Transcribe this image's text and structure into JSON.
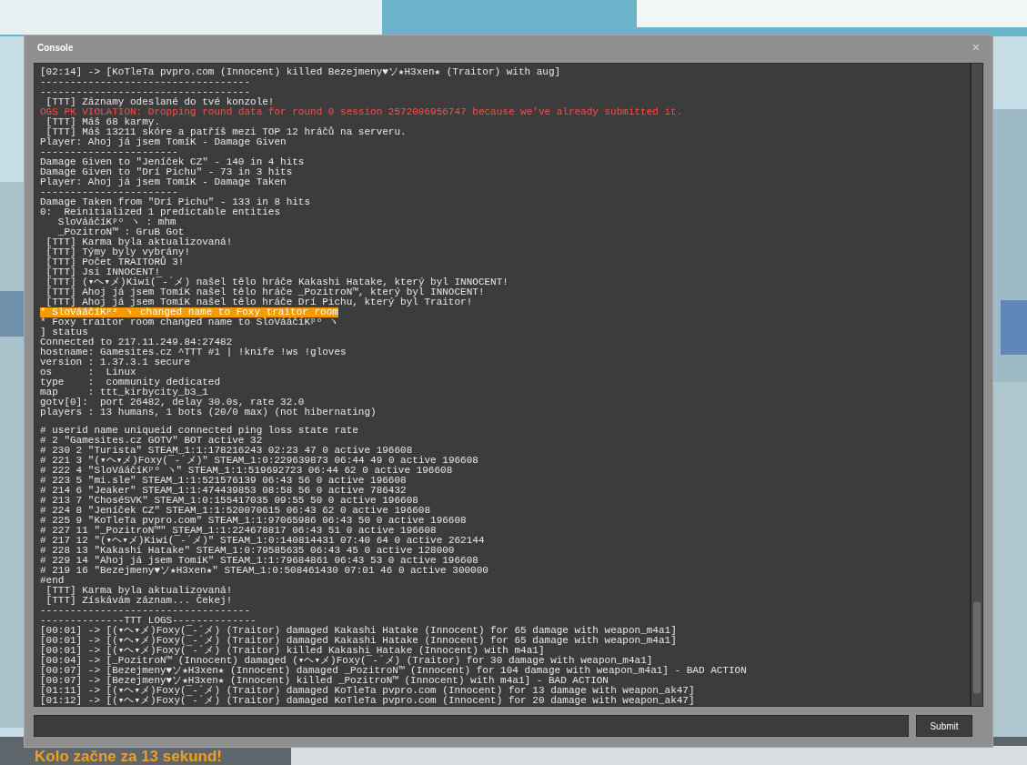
{
  "window": {
    "title": "Console",
    "close": "×"
  },
  "log": [
    {
      "kind": "normal",
      "text": "[02:14] -> [KoTleTa pvpro.com (Innocent) killed Bezejmeny♥ソ★H3xen★ (Traitor) with aug]"
    },
    {
      "kind": "normal",
      "text": "-----------------------------------"
    },
    {
      "kind": "normal",
      "text": "-----------------------------------"
    },
    {
      "kind": "normal",
      "text": " [TTT] Záznamy odeslané do tvé konzole!"
    },
    {
      "kind": "error",
      "text": "OGS PK VIOLATION: Dropping round data for round 0 session 2572006956747 because we've already submitted it."
    },
    {
      "kind": "normal",
      "text": " [TTT] Máš 68 karmy."
    },
    {
      "kind": "normal",
      "text": " [TTT] Máš 13211 skóre a patříš mezi TOP 12 hráčů na serveru."
    },
    {
      "kind": "normal",
      "text": "Player: Ahoj já jsem TomíK - Damage Given"
    },
    {
      "kind": "normal",
      "text": "-----------------------"
    },
    {
      "kind": "normal",
      "text": "Damage Given to \"Jeníček CZ\" - 140 in 4 hits"
    },
    {
      "kind": "normal",
      "text": "Damage Given to \"Drí Pichu\" - 73 in 3 hits"
    },
    {
      "kind": "normal",
      "text": "Player: Ahoj já jsem TomíK - Damage Taken"
    },
    {
      "kind": "normal",
      "text": "-----------------------"
    },
    {
      "kind": "normal",
      "text": "Damage Taken from \"Drí Pichu\" - 133 in 8 hits"
    },
    {
      "kind": "normal",
      "text": "0:  Reinitialized 1 predictable entities"
    },
    {
      "kind": "normal",
      "text": "   SloVááčíKᵖᵒ ヽ : mhm"
    },
    {
      "kind": "normal",
      "text": "   _PozitroN™ : GruB Got"
    },
    {
      "kind": "normal",
      "text": " [TTT] Karma byla aktualizovaná!"
    },
    {
      "kind": "normal",
      "text": " [TTT] Týmy byly vybrány!"
    },
    {
      "kind": "normal",
      "text": " [TTT] Počet TRAITORŮ 3!"
    },
    {
      "kind": "normal",
      "text": " [TTT] Jsi INNOCENT!"
    },
    {
      "kind": "normal",
      "text": " [TTT] (▾ヘ▾メ)Kiwi(¯-´メ) našel tělo hráče Kakashi Hatake, který byl INNOCENT!"
    },
    {
      "kind": "normal",
      "text": " [TTT] Ahoj já jsem TomíK našel tělo hráče _PozitroN™, který byl INNOCENT!"
    },
    {
      "kind": "normal",
      "text": " [TTT] Ahoj já jsem TomíK našel tělo hráče Drí Pichu, který byl Traitor!"
    },
    {
      "kind": "highlight",
      "text": "* SloVááčíKᵖᵒ ヽ changed name to Foxy traitor room"
    },
    {
      "kind": "normal",
      "text": "* Foxy traitor room changed name to SloVááčíKᵖᵒ ヽ"
    },
    {
      "kind": "normal",
      "text": "] status"
    },
    {
      "kind": "normal",
      "text": "Connected to 217.11.249.84:27482"
    },
    {
      "kind": "normal",
      "text": "hostname: Gamesites.cz ^TTT #1 | !knife !ws !gloves"
    },
    {
      "kind": "normal",
      "text": "version : 1.37.3.1 secure"
    },
    {
      "kind": "normal",
      "text": "os      :  Linux"
    },
    {
      "kind": "normal",
      "text": "type    :  community dedicated"
    },
    {
      "kind": "normal",
      "text": "map     : ttt_kirbycity_b3_1"
    },
    {
      "kind": "normal",
      "text": "gotv[0]:  port 26482, delay 30.0s, rate 32.0"
    },
    {
      "kind": "normal",
      "text": "players : 13 humans, 1 bots (20/0 max) (not hibernating)"
    },
    {
      "kind": "blank"
    },
    {
      "kind": "normal",
      "text": "# userid name uniqueid connected ping loss state rate"
    },
    {
      "kind": "normal",
      "text": "# 2 \"Gamesites.cz GOTV\" BOT active 32"
    },
    {
      "kind": "normal",
      "text": "# 230 2 \"Turista\" STEAM_1:1:178216243 02:23 47 0 active 196608"
    },
    {
      "kind": "normal",
      "text": "# 221 3 \"(▾ヘ▾メ)Foxy(¯-´メ)\" STEAM_1:0:229639873 06:44 49 0 active 196608"
    },
    {
      "kind": "normal",
      "text": "# 222 4 \"SloVááčíKᵖᵒ ヽ\" STEAM_1:1:519692723 06:44 62 0 active 196608"
    },
    {
      "kind": "normal",
      "text": "# 223 5 \"mi.sle\" STEAM_1:1:521576139 06:43 56 0 active 196608"
    },
    {
      "kind": "normal",
      "text": "# 214 6 \"Jeaker\" STEAM_1:1:474439853 08:58 56 0 active 786432"
    },
    {
      "kind": "normal",
      "text": "# 213 7 \"ChoséSVK\" STEAM_1:0:155417035 09:55 50 0 active 196608"
    },
    {
      "kind": "normal",
      "text": "# 224 8 \"Jeníček CZ\" STEAM_1:1:520070615 06:43 62 0 active 196608"
    },
    {
      "kind": "normal",
      "text": "# 225 9 \"KoTleTa pvpro.com\" STEAM_1:1:97065986 06:43 50 0 active 196608"
    },
    {
      "kind": "normal",
      "text": "# 227 11 \"_PozitroN™\" STEAM_1:1:224678817 06:43 51 0 active 196608"
    },
    {
      "kind": "normal",
      "text": "# 217 12 \"(▾ヘ▾メ)Kiwi(¯-´メ)\" STEAM_1:0:140814431 07:40 64 0 active 262144"
    },
    {
      "kind": "normal",
      "text": "# 228 13 \"Kakashi Hatake\" STEAM_1:0:79585635 06:43 45 0 active 128000"
    },
    {
      "kind": "normal",
      "text": "# 229 14 \"Ahoj já jsem TomíK\" STEAM_1:1:79684861 06:43 53 0 active 196608"
    },
    {
      "kind": "normal",
      "text": "# 219 16 \"Bezejmeny♥ソ★H3xen★\" STEAM_1:0:508461430 07:01 46 0 active 300000"
    },
    {
      "kind": "normal",
      "text": "#end"
    },
    {
      "kind": "normal",
      "text": " [TTT] Karma byla aktualizovaná!"
    },
    {
      "kind": "normal",
      "text": " [TTT] Získávám záznam... Čekej!"
    },
    {
      "kind": "normal",
      "text": "-----------------------------------"
    },
    {
      "kind": "normal",
      "text": "--------------TTT LOGS--------------"
    },
    {
      "kind": "normal",
      "text": "[00:01] -> [(▾ヘ▾メ)Foxy(¯-´メ) (Traitor) damaged Kakashi Hatake (Innocent) for 65 damage with weapon_m4a1]"
    },
    {
      "kind": "normal",
      "text": "[00:01] -> [(▾ヘ▾メ)Foxy(¯-´メ) (Traitor) damaged Kakashi Hatake (Innocent) for 65 damage with weapon_m4a1]"
    },
    {
      "kind": "normal",
      "text": "[00:01] -> [(▾ヘ▾メ)Foxy(¯-´メ) (Traitor) killed Kakashi Hatake (Innocent) with m4a1]"
    },
    {
      "kind": "normal",
      "text": "[00:04] -> [_PozitroN™ (Innocent) damaged (▾ヘ▾メ)Foxy(¯-´メ) (Traitor) for 30 damage with weapon_m4a1]"
    },
    {
      "kind": "normal",
      "text": "[00:07] -> [Bezejmeny♥ソ★H3xen★ (Innocent) damaged _PozitroN™ (Innocent) for 104 damage with weapon_m4a1] - BAD ACTION"
    },
    {
      "kind": "normal",
      "text": "[00:07] -> [Bezejmeny♥ソ★H3xen★ (Innocent) killed _PozitroN™ (Innocent) with m4a1] - BAD ACTION"
    },
    {
      "kind": "normal",
      "text": "[01:11] -> [(▾ヘ▾メ)Foxy(¯-´メ) (Traitor) damaged KoTleTa pvpro.com (Innocent) for 13 damage with weapon_ak47]"
    },
    {
      "kind": "normal",
      "text": "[01:12] -> [(▾ヘ▾メ)Foxy(¯-´メ) (Traitor) damaged KoTleTa pvpro.com (Innocent) for 20 damage with weapon_ak47]"
    }
  ],
  "submit_button": "Submit",
  "hud_message": "Kolo začne za 13 sekund!"
}
